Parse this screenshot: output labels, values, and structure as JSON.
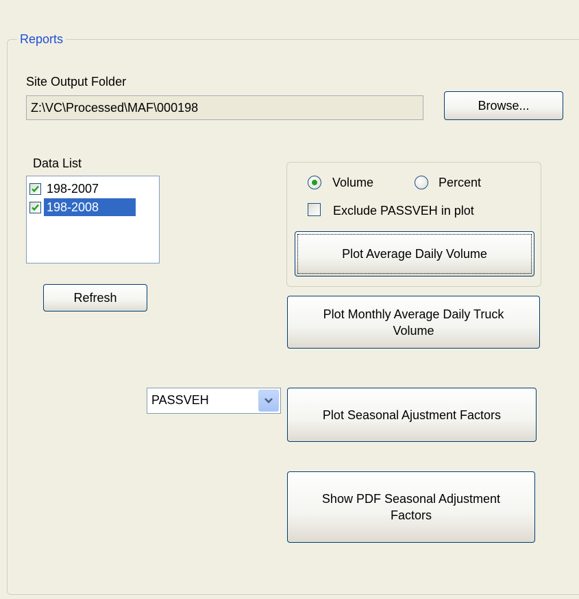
{
  "reports": {
    "title": "Reports",
    "site_output_folder_label": "Site Output Folder",
    "site_output_folder_value": "Z:\\VC\\Processed\\MAF\\000198",
    "browse_label": "Browse...",
    "data_list_label": "Data List",
    "data_list_items": [
      {
        "label": "198-2007",
        "checked": true,
        "selected": false
      },
      {
        "label": "198-2008",
        "checked": true,
        "selected": true
      }
    ],
    "refresh_label": "Refresh",
    "options": {
      "volume_label": "Volume",
      "percent_label": "Percent",
      "selected_mode": "Volume",
      "exclude_label": "Exclude PASSVEH in plot",
      "exclude_checked": false
    },
    "plot_avg_daily_volume_label": "Plot Average Daily Volume",
    "plot_monthly_truck_label": "Plot Monthly Average Daily Truck Volume",
    "vehicle_class_selected": "PASSVEH",
    "plot_seasonal_label": "Plot Seasonal Ajustment Factors",
    "show_pdf_label": "Show PDF Seasonal Adjustment Factors"
  },
  "colors": {
    "background": "#f1efe2",
    "group_title": "#1e4ed8",
    "selection": "#316ac5",
    "check_green": "#21a121",
    "button_border": "#003c74"
  },
  "icons": {
    "check": "checkmark-icon",
    "radio": "radio-dot-icon",
    "dropdown": "chevron-down-icon"
  }
}
